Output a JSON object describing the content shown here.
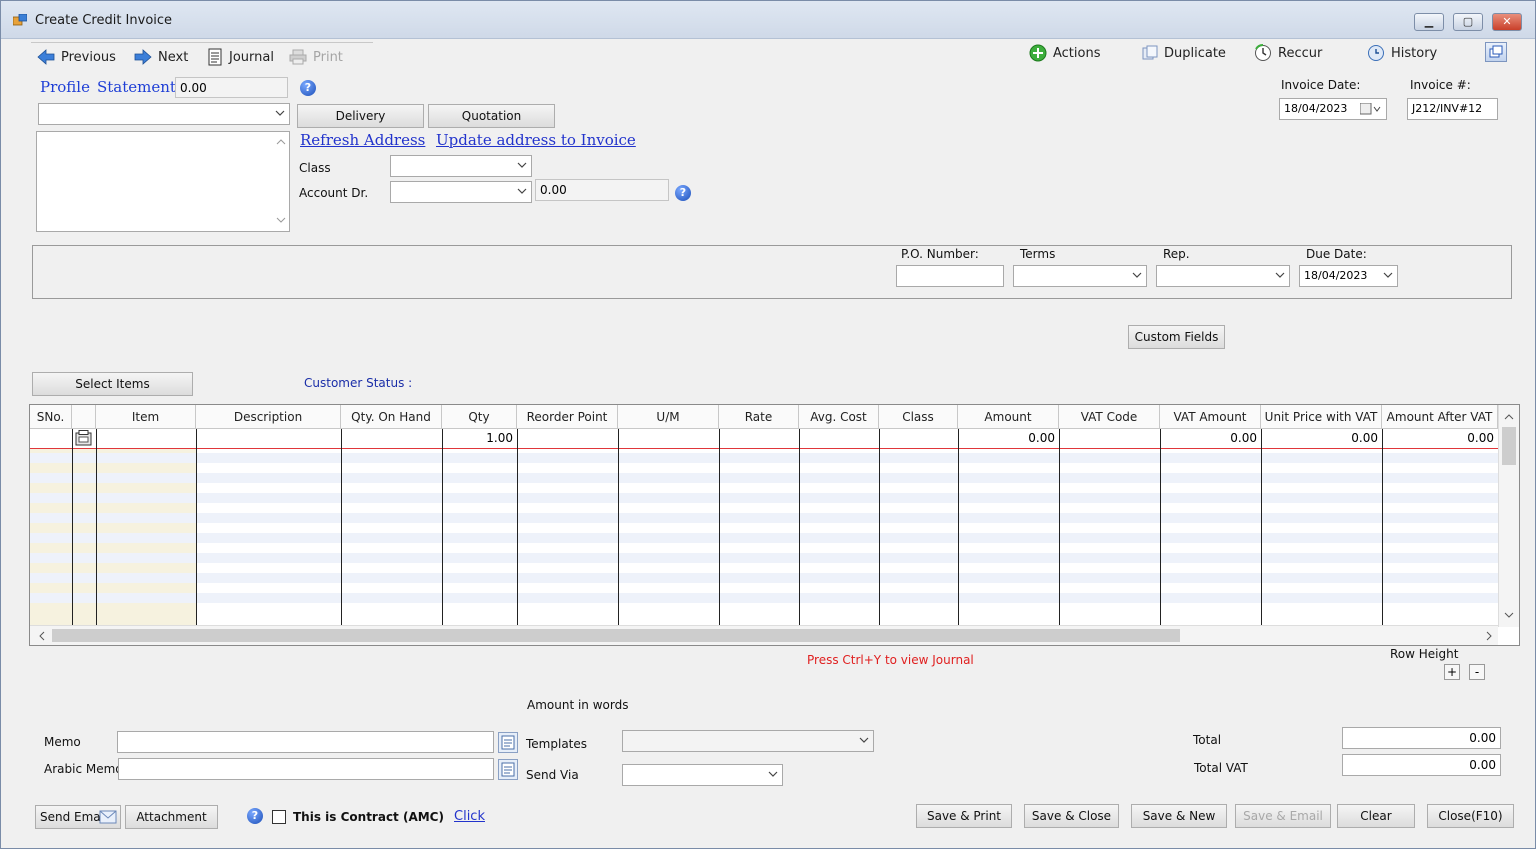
{
  "window": {
    "title": "Create Credit Invoice"
  },
  "toolbar": {
    "previous": "Previous",
    "next": "Next",
    "journal": "Journal",
    "print": "Print",
    "actions": "Actions",
    "duplicate": "Duplicate",
    "reccur": "Reccur",
    "history": "History"
  },
  "customer": {
    "profile": "Profile",
    "statement": "Statement",
    "balance": "0.00",
    "selected": "",
    "address": ""
  },
  "buttons": {
    "delivery": "Delivery",
    "quotation": "Quotation",
    "custom_fields": "Custom Fields",
    "select_items": "Select Items",
    "send_email": "Send Email",
    "attachment": "Attachment",
    "save_print": "Save & Print",
    "save_close": "Save & Close",
    "save_new": "Save & New",
    "save_email": "Save & Email",
    "clear": "Clear",
    "close": "Close(F10)"
  },
  "links": {
    "refresh_address": "Refresh Address",
    "update_address": "Update address to Invoice",
    "click": "Click"
  },
  "fields": {
    "class_label": "Class",
    "class_value": "",
    "account_label": "Account Dr.",
    "account_value": "",
    "account_balance": "0.00",
    "invoice_date_label": "Invoice Date:",
    "invoice_date": "18/04/2023",
    "invoice_no_label": "Invoice #:",
    "invoice_no": "J212/INV#12",
    "po_label": "P.O. Number:",
    "po_value": "",
    "terms_label": "Terms",
    "terms_value": "",
    "rep_label": "Rep.",
    "rep_value": "",
    "due_date_label": "Due Date:",
    "due_date": "18/04/2023"
  },
  "status": {
    "customer_status": "Customer Status :",
    "journal_hint": "Press Ctrl+Y to view Journal",
    "row_height": "Row Height",
    "plus": "+",
    "minus": "-"
  },
  "grid": {
    "columns": [
      "SNo.",
      "",
      "Item",
      "Description",
      "Qty. On Hand",
      "Qty",
      "Reorder Point",
      "U/M",
      "Rate",
      "Avg. Cost",
      "Class",
      "Amount",
      "VAT Code",
      "VAT Amount",
      "Unit Price with VAT",
      "Amount After VAT"
    ],
    "row": {
      "qty": "1.00",
      "amount": "0.00",
      "vat_amount": "0.00",
      "unit_price_vat": "0.00",
      "amount_after_vat": "0.00"
    }
  },
  "footer": {
    "amount_in_words": "Amount in words",
    "memo_label": "Memo",
    "memo": "",
    "arabic_memo_label": "Arabic Memo",
    "arabic_memo": "",
    "templates_label": "Templates",
    "templates_value": "",
    "send_via_label": "Send Via",
    "send_via_value": "",
    "total_label": "Total",
    "total": "0.00",
    "total_vat_label": "Total VAT",
    "total_vat": "0.00",
    "contract_label": "This is Contract (AMC)"
  }
}
